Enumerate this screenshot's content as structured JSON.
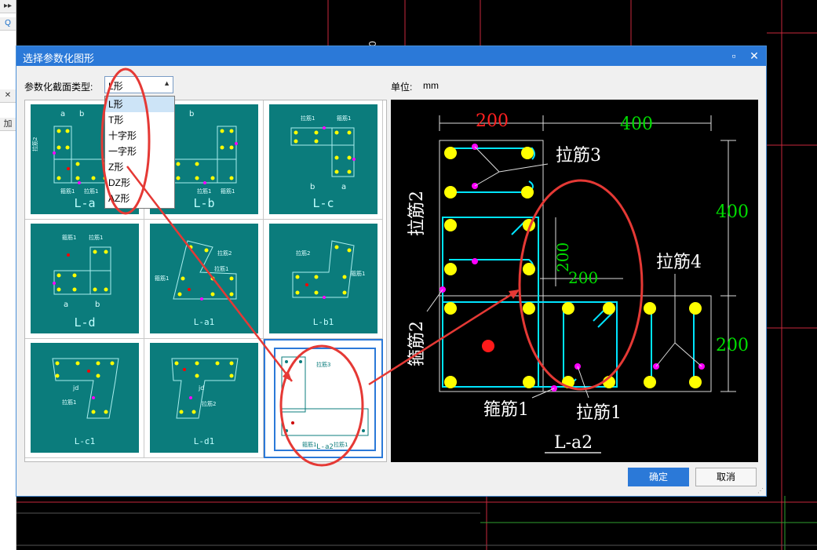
{
  "dialog": {
    "title": "选择参数化图形",
    "type_label": "参数化截面类型:",
    "unit_label": "单位:",
    "unit_value": "mm",
    "selected_type": "L形",
    "type_options": [
      "L形",
      "T形",
      "十字形",
      "一字形",
      "Z形",
      "DZ形",
      "AZ形"
    ],
    "ok_label": "确定",
    "cancel_label": "取消"
  },
  "thumbnails": [
    {
      "name": "L-a",
      "dims": [
        "a",
        "b"
      ],
      "labels": [
        "拉筋2",
        "箍筋2",
        "箍筋1",
        "拉筋1"
      ]
    },
    {
      "name": "L-b",
      "dims": [
        "b",
        "a"
      ],
      "labels": [
        "拉筋2",
        "箍筋2",
        "拉筋1",
        "箍筋1"
      ]
    },
    {
      "name": "L-c",
      "dims": [
        "b",
        "a",
        "c",
        "d"
      ],
      "labels": [
        "拉筋1",
        "箍筋1",
        "箍筋2",
        "拉筋2"
      ]
    },
    {
      "name": "L-d",
      "dims": [
        "a",
        "b",
        "c",
        "d"
      ],
      "labels": [
        "箍筋1",
        "拉筋1",
        "箍筋2",
        "拉筋2"
      ]
    },
    {
      "name": "L-a1",
      "dims": [
        "a",
        "b",
        "c",
        "jd"
      ],
      "labels": [
        "拉筋2",
        "箍筋1",
        "拉筋1",
        "箍筋1"
      ]
    },
    {
      "name": "L-b1",
      "dims": [
        "a",
        "b",
        "c",
        "jd"
      ],
      "labels": [
        "拉筋2",
        "拉筋1",
        "箍筋1",
        "箍筋1"
      ]
    },
    {
      "name": "L-c1",
      "dims": [
        "b",
        "a",
        "jd"
      ],
      "labels": [
        "箍筋1",
        "箍筋2",
        "拉筋1",
        "拉筋2"
      ]
    },
    {
      "name": "L-d1",
      "dims": [
        "b",
        "a",
        "jd"
      ],
      "labels": [
        "箍筋1",
        "箍筋2",
        "拉筋1",
        "拉筋2"
      ]
    },
    {
      "name": "L-a2",
      "dims": [],
      "labels": [
        "拉筋3",
        "拉筋2",
        "拉筋4",
        "箍筋2",
        "箍筋1",
        "拉筋1"
      ]
    }
  ],
  "preview": {
    "name": "L-a2",
    "dim_top_left": "200",
    "dim_top_right": "400",
    "dim_right_top": "400",
    "dim_right_bottom": "200",
    "dim_inner_v": "200",
    "dim_inner_h": "200",
    "label_tie3": "拉筋3",
    "label_tie2": "拉筋2",
    "label_tie4": "拉筋4",
    "label_stirrup2": "箍筋2",
    "label_stirrup1": "箍筋1",
    "label_tie1": "拉筋1"
  },
  "left_strip": {
    "button_1": "▸▸",
    "button_2": "Q",
    "button_3": "✕",
    "button_4": "加"
  },
  "colors": {
    "titlebar": "#2b79d8",
    "thumb_bg": "#0b7c7c",
    "rebar": "#ffff00",
    "tie_point": "#ff00ff",
    "stirrup": "#00e5ff",
    "dim_green": "#00dd00",
    "dim_red": "#ff2020",
    "annotation": "#e53935"
  }
}
